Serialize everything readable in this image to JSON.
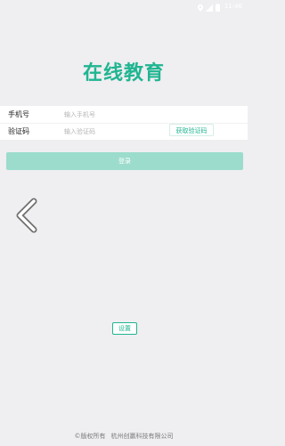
{
  "status_bar": {
    "time": "11:46",
    "icons": [
      "location-icon",
      "signal-icon",
      "battery-icon"
    ]
  },
  "app": {
    "title": "在线教育"
  },
  "form": {
    "phone": {
      "label": "手机号",
      "placeholder": "输入手机号",
      "value": ""
    },
    "code": {
      "label": "验证码",
      "placeholder": "输入验证码",
      "value": "",
      "get_code_label": "获取验证码"
    },
    "login_label": "登录"
  },
  "nav": {
    "back_icon": "chevron-left-icon"
  },
  "settings": {
    "label": "设置"
  },
  "footer": {
    "copyright": "©版权所有",
    "company": "杭州创赢科技有限公司"
  },
  "colors": {
    "accent": "#20b591",
    "login_button": "#9cdccc",
    "background": "#efeef1"
  }
}
